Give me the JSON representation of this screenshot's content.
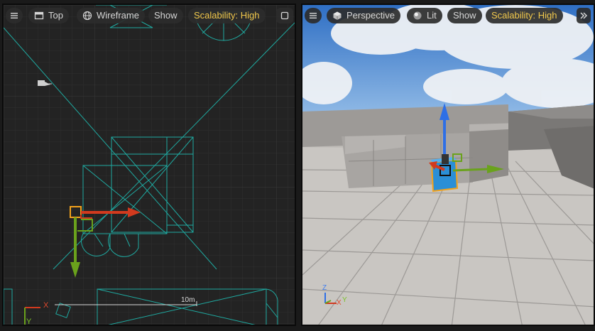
{
  "left_viewport": {
    "menu_icon": "hamburger-menu-icon",
    "view_mode": "Top",
    "render_mode": "Wireframe",
    "show_label": "Show",
    "scalability": "Scalability: High",
    "maximize_icon": "maximize-square-icon",
    "scale_label": "10m",
    "axis_x": "X",
    "axis_y": "Y"
  },
  "right_viewport": {
    "menu_icon": "hamburger-menu-icon",
    "view_mode": "Perspective",
    "render_mode": "Lit",
    "show_label": "Show",
    "scalability": "Scalability: High",
    "overflow_icon": "double-chevron-right-icon",
    "axis_x": "X",
    "axis_y": "Y",
    "axis_z": "Z"
  },
  "colors": {
    "wire": "#1fa9a0",
    "gizmo_x": "#d23a1e",
    "gizmo_y": "#6aa21c",
    "gizmo_z": "#2e6fe6",
    "accent": "#f2c94c"
  }
}
